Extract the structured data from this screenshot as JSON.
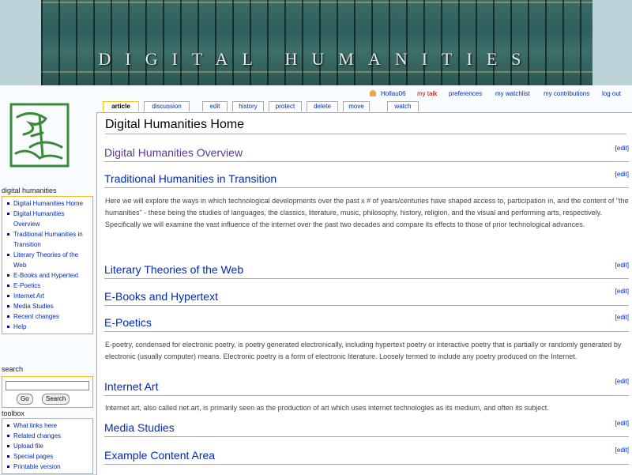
{
  "banner": {
    "title": "DIGITAL HUMANITIES"
  },
  "personal": {
    "user": "Hollau06",
    "my_talk": "my talk",
    "preferences": "preferences",
    "my_watchlist": "my watchlist",
    "my_contributions": "my contributions",
    "log_out": "log out"
  },
  "tabs": {
    "article": "article",
    "discussion": "discussion",
    "edit": "edit",
    "history": "history",
    "protect": "protect",
    "delete": "delete",
    "move": "move",
    "watch": "watch"
  },
  "sidebar": {
    "nav_title": "digital humanities",
    "nav_items": [
      "Digital Humanities Home",
      "Digital Humanities Overview",
      "Traditional Humanities in Transition",
      "Literary Theories of the Web",
      "E-Books and Hypertext",
      "E-Poetics",
      "Internet Art",
      "Media Studies",
      "Recent changes",
      "Help"
    ],
    "search_title": "search",
    "go_button": "Go",
    "search_button": "Search",
    "toolbox_title": "toolbox",
    "toolbox_items": [
      "What links here",
      "Related changes",
      "Upload file",
      "Special pages",
      "Printable version"
    ]
  },
  "content": {
    "page_title": "Digital Humanities Home",
    "edit_label": "[edit]",
    "sections": {
      "overview": "Digital Humanities Overview",
      "traditional": "Traditional Humanities in Transition",
      "traditional_text": "Here we will explore the ways in which technological developments over the past x # of years/centuries have shaped access to, participation in, and the content of \"the humanities\" - these being the studies of languages, the classics, literature, music, philosophy, history, religion, and the visual and performing arts, respectively. Specifically we will examine the vast influence of the internet over the past two decades and compare its effects to those of prior technological advances.",
      "literary": "Literary Theories of the Web",
      "ebooks": "E-Books and Hypertext",
      "epoetics": "E-Poetics",
      "epoetics_text": "E-poetry, condensed for electronic poetry, is poetry generated electronically, including hypertext poetry or interactive poetry that is partially or randomly generated by electronic (usually computer) means. Electronic poetry is a form of electronic literature. Loosely termed to include any poetry produced on the Internet.",
      "internet_art": "Internet Art",
      "internet_art_text": "Internet art, also called net.art, is primarily seen as the production of art which uses internet technologies as its medium, and often its subject.",
      "media": "Media Studies",
      "example": "Example Content Area"
    }
  }
}
